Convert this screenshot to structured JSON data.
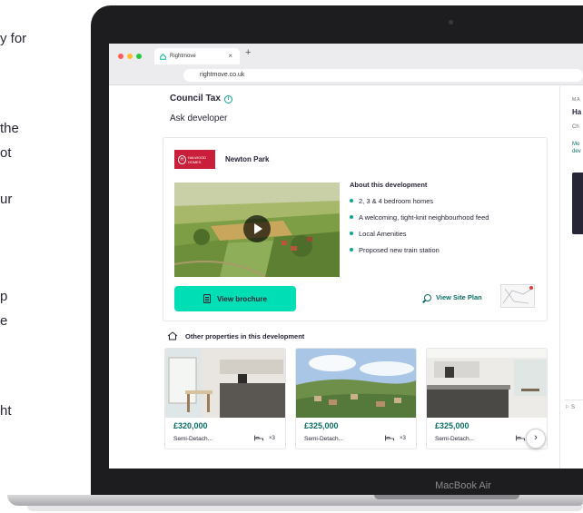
{
  "background_fragments": [
    "y for",
    "the",
    "ot",
    "ur",
    "p",
    "e",
    "ht"
  ],
  "laptop": {
    "model": "MacBook Air"
  },
  "browser": {
    "tab_title": "Rightmove",
    "tab_close": "×",
    "new_tab": "+",
    "url": "rightmove.co.uk"
  },
  "page": {
    "council_tax_label": "Council Tax",
    "info_glyph": "i",
    "ask_developer": "Ask developer",
    "development": {
      "logo_text": "HALWOOD HOMES",
      "logo_mark": "H",
      "name": "Newton Park",
      "about_title": "About this development",
      "features": [
        "2, 3 & 4 bedroom homes",
        "A welcoming, tight-knit neighbourhood feed",
        "Local Amenities",
        "Proposed new train station"
      ],
      "brochure_label": "View brochure",
      "site_plan_label": "View Site Plan"
    },
    "other_properties_title": "Other properties in this development",
    "properties": [
      {
        "price": "£320,000",
        "type": "Semi-Detach...",
        "beds": "×3"
      },
      {
        "price": "£325,000",
        "type": "Semi-Detach...",
        "beds": "×3"
      },
      {
        "price": "£325,000",
        "type": "Semi-Detach...",
        "beds": "×3"
      }
    ],
    "next_glyph": "›"
  },
  "right_panel": {
    "label": "MA",
    "name": "Ha",
    "sub": "Ch",
    "more_line1": "Mo",
    "more_line2": "dev",
    "bottom": "S"
  },
  "colors": {
    "accent": "#00deb6",
    "link": "#0b6e63",
    "bullet": "#0aa68f",
    "logo_red": "#c91f3a",
    "text": "#262637"
  }
}
